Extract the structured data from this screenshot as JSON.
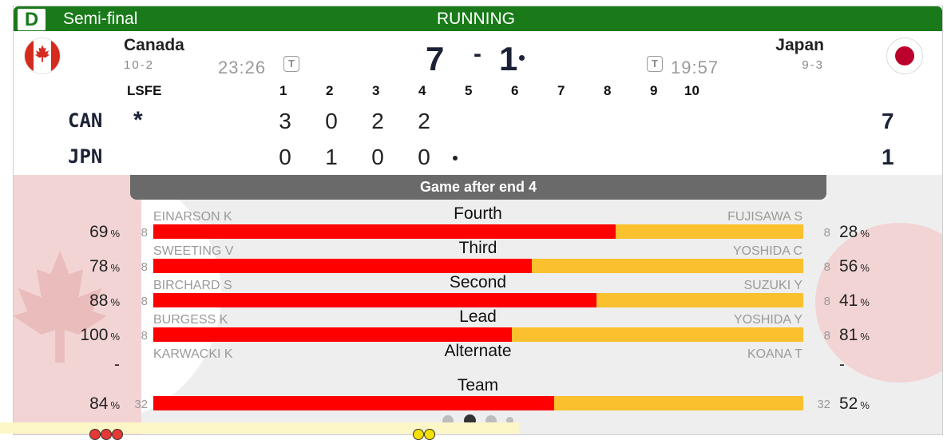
{
  "header": {
    "sheet": "D",
    "round": "Semi-final",
    "status": "RUNNING"
  },
  "teams": {
    "home": {
      "name": "Canada",
      "abbr": "CAN",
      "record": "10-2",
      "clock": "23:26",
      "timeout_icon": "T",
      "score": "7",
      "flag_icon": "canada-flag-icon"
    },
    "away": {
      "name": "Japan",
      "abbr": "JPN",
      "record": "9-3",
      "clock": "19:57",
      "timeout_icon": "T",
      "score": "1",
      "flag_icon": "japan-flag-icon"
    }
  },
  "score_separator": "-",
  "linescore": {
    "lsfe_label": "LSFE",
    "lsfe_marker": "*",
    "ends": [
      "1",
      "2",
      "3",
      "4",
      "5",
      "6",
      "7",
      "8",
      "9",
      "10"
    ],
    "home_ends": [
      "3",
      "0",
      "2",
      "2",
      "",
      "",
      "",
      "",
      "",
      ""
    ],
    "away_ends": [
      "0",
      "1",
      "0",
      "0",
      "",
      "",
      "",
      "",
      "",
      ""
    ],
    "hammer_icon": "hammer-dot-icon",
    "home_total": "7",
    "away_total": "1"
  },
  "stats": {
    "summary": "Game after end 4",
    "percent_unit": "%",
    "rows": [
      {
        "position": "Fourth",
        "home_player": "EINARSON K",
        "away_player": "FUJISAWA S",
        "home_pct": "69",
        "away_pct": "28",
        "home_shots": "8",
        "away_shots": "8",
        "home_share": 0.711
      },
      {
        "position": "Third",
        "home_player": "SWEETING V",
        "away_player": "YOSHIDA C",
        "home_pct": "78",
        "away_pct": "56",
        "home_shots": "8",
        "away_shots": "8",
        "home_share": 0.582
      },
      {
        "position": "Second",
        "home_player": "BIRCHARD S",
        "away_player": "SUZUKI Y",
        "home_pct": "88",
        "away_pct": "41",
        "home_shots": "8",
        "away_shots": "8",
        "home_share": 0.682
      },
      {
        "position": "Lead",
        "home_player": "BURGESS K",
        "away_player": "YOSHIDA Y",
        "home_pct": "100",
        "away_pct": "81",
        "home_shots": "8",
        "away_shots": "8",
        "home_share": 0.552
      },
      {
        "position": "Alternate",
        "home_player": "KARWACKI K",
        "away_player": "KOANA T",
        "home_pct": "-",
        "away_pct": "-",
        "home_shots": "",
        "away_shots": "",
        "home_share": null
      },
      {
        "position": "Team",
        "home_player": "",
        "away_player": "",
        "home_pct": "84",
        "away_pct": "52",
        "home_shots": "32",
        "away_shots": "32",
        "home_share": 0.617
      }
    ]
  },
  "pager": {
    "pages": 4,
    "active": 2
  },
  "colors": {
    "header_green": "#1a7a1a",
    "home_bar": "#ff0000",
    "away_bar": "#fbc02d",
    "summary_bg": "#6a6a6a",
    "navy": "#1b2235"
  }
}
